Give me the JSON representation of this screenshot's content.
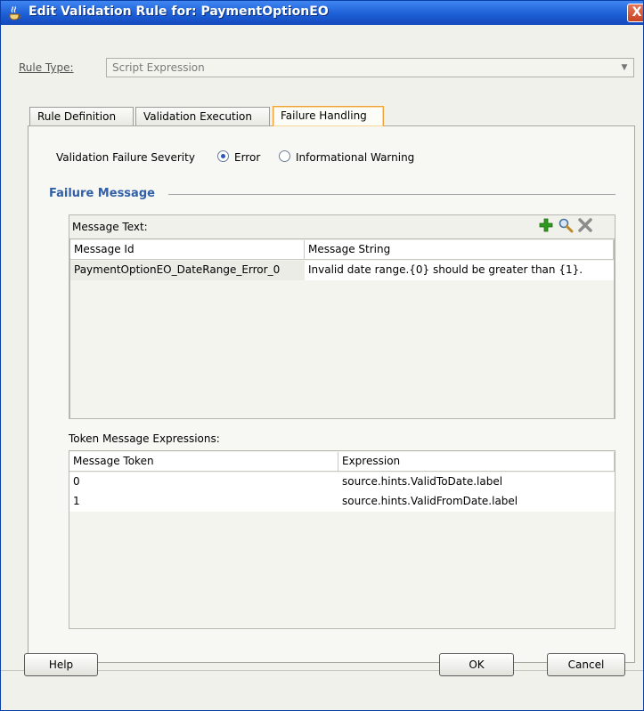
{
  "window": {
    "title": "Edit Validation Rule for: PaymentOptionEO",
    "close_glyph": "X"
  },
  "rule_type": {
    "label": "Rule Type:",
    "value": "Script Expression"
  },
  "tabs": [
    {
      "label": "Rule Definition"
    },
    {
      "label": "Validation Execution"
    },
    {
      "label": "Failure Handling",
      "active": true
    }
  ],
  "severity": {
    "label": "Validation Failure Severity",
    "options": [
      {
        "label": "Error",
        "selected": true
      },
      {
        "label": "Informational Warning",
        "selected": false
      }
    ]
  },
  "failure_message": {
    "title": "Failure Message",
    "message_text_label": "Message Text:",
    "toolbar": [
      "add-icon",
      "search-icon",
      "delete-icon"
    ],
    "columns": [
      "Message Id",
      "Message String"
    ],
    "rows": [
      [
        "PaymentOptionEO_DateRange_Error_0",
        "Invalid date range.{0} should be greater than {1}."
      ]
    ]
  },
  "token_expressions": {
    "label": "Token Message Expressions:",
    "columns": [
      "Message Token",
      "Expression"
    ],
    "rows": [
      [
        "0",
        "source.hints.ValidToDate.label"
      ],
      [
        "1",
        "source.hints.ValidFromDate.label"
      ]
    ]
  },
  "buttons": {
    "help": "Help",
    "ok": "OK",
    "cancel": "Cancel"
  },
  "colors": {
    "titlebar": "#1d5fd6",
    "section_title": "#315fa8",
    "active_tab_border": "#f0a238",
    "add_icon": "#2e9a1e"
  }
}
